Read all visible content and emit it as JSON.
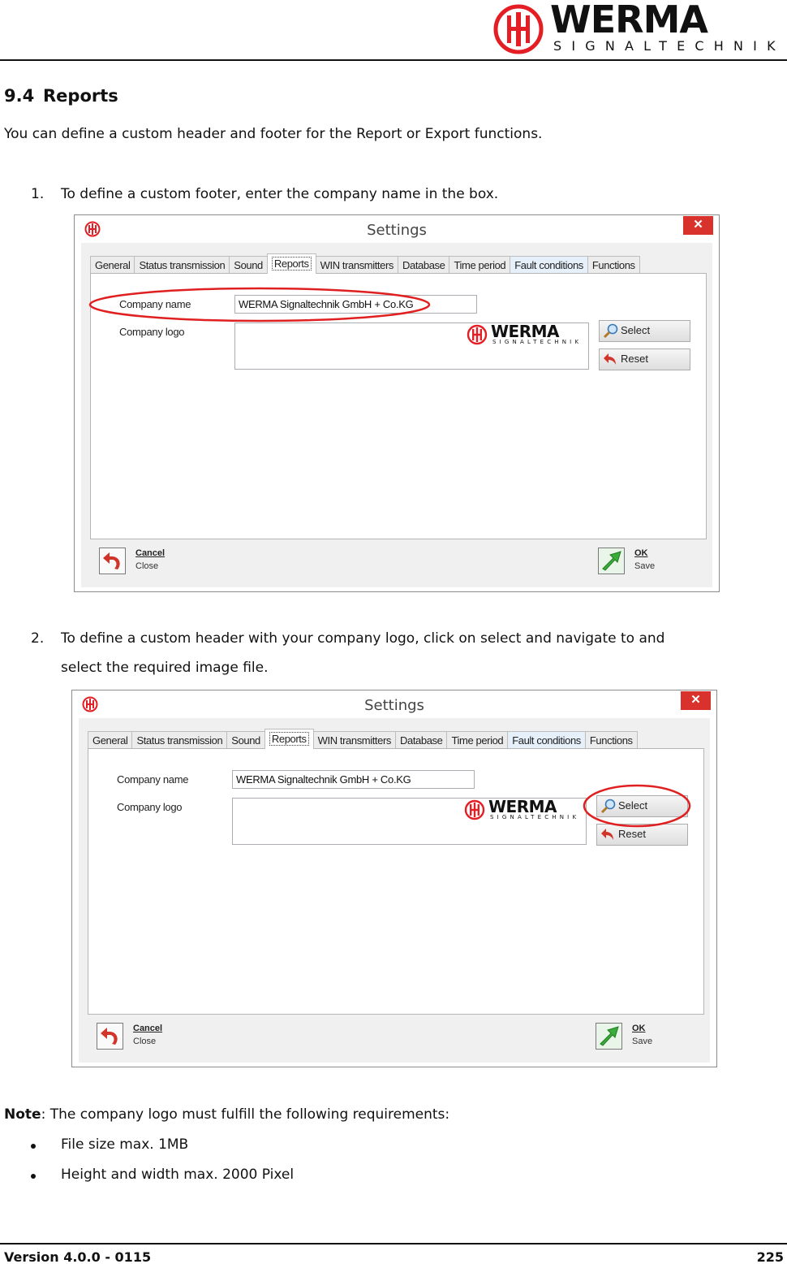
{
  "brand": {
    "name": "WERMA",
    "tagline": "SIGNALTECHNIK",
    "color": "#e31e24"
  },
  "section": {
    "number": "9.4",
    "title": "Reports",
    "intro": "You can define a custom header and footer for the Report or Export functions."
  },
  "steps": [
    {
      "number": "1.",
      "text": "To define a custom footer, enter the company name in the box."
    },
    {
      "number": "2.",
      "line1": "To define a custom header with your company logo, click on select and navigate to and",
      "line2": "select the required image file."
    }
  ],
  "dialog": {
    "title": "Settings",
    "close_glyph": "✕",
    "tabs": [
      "General",
      "Status transmission",
      "Sound",
      "Reports",
      "WIN transmitters",
      "Database",
      "Time period",
      "Fault conditions",
      "Functions"
    ],
    "company_name_label": "Company name",
    "company_logo_label": "Company logo",
    "company_name_value": "WERMA Signaltechnik GmbH + Co.KG",
    "logo_brand": "WERMA",
    "logo_tagline": "SIGNALTECHNIK",
    "select_label": "Select",
    "reset_label": "Reset",
    "cancel_label": "Cancel",
    "cancel_hint": "Close",
    "ok_label": "OK",
    "ok_hint": "Save"
  },
  "note": {
    "label": "Note",
    "text": ": The company logo must fulfill the following requirements:",
    "items": [
      "File size max. 1MB",
      "Height and width max. 2000 Pixel"
    ]
  },
  "footer": {
    "version": "Version 4.0.0 - 0115",
    "page": "225"
  }
}
